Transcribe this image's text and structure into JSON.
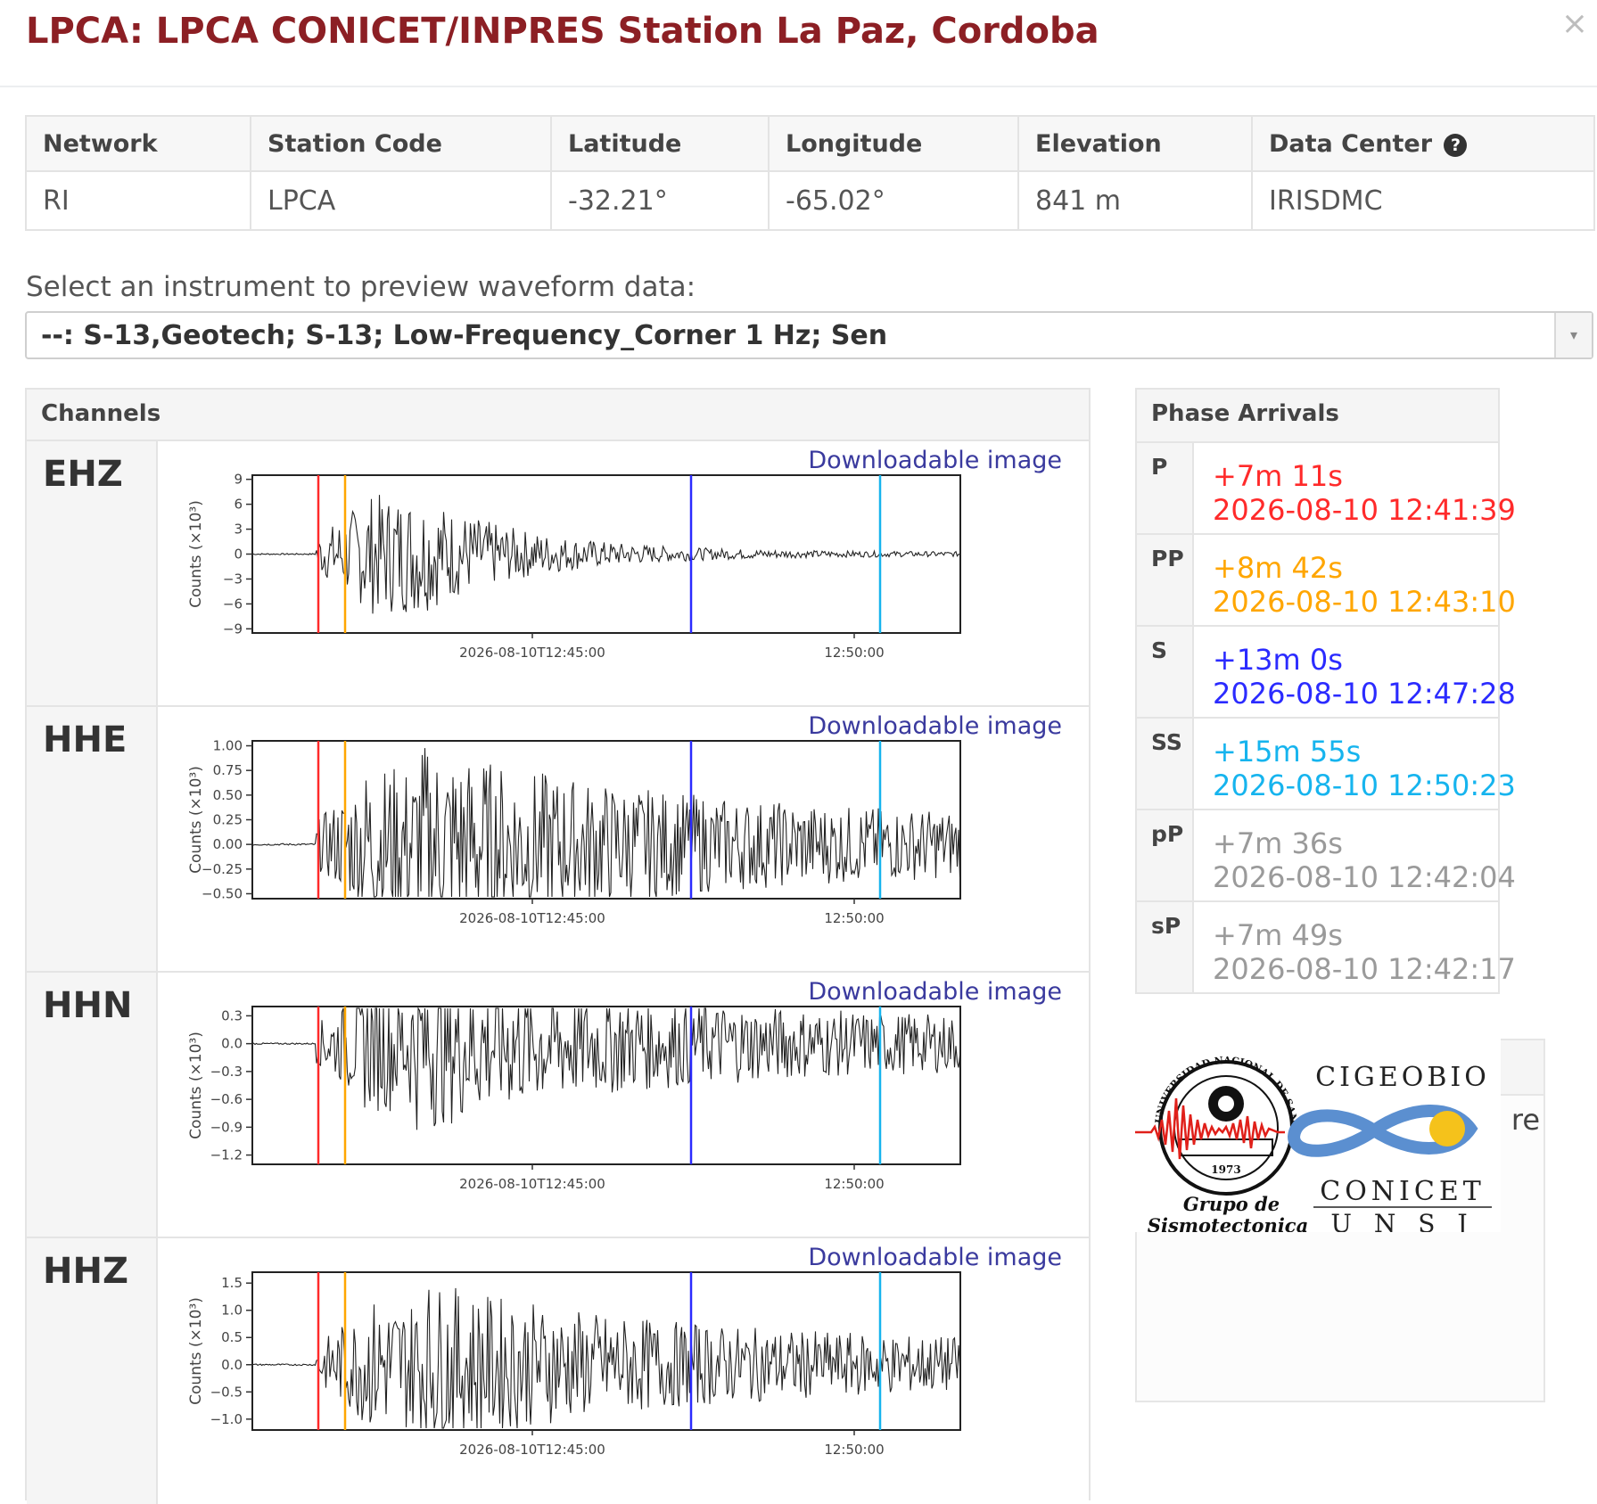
{
  "modal": {
    "title": "LPCA: LPCA CONICET/INPRES Station La Paz, Cordoba",
    "close": "×"
  },
  "station_table": {
    "headers": [
      "Network",
      "Station Code",
      "Latitude",
      "Longitude",
      "Elevation",
      "Data Center"
    ],
    "row": [
      "RI",
      "LPCA",
      "-32.21°",
      "-65.02°",
      "841 m",
      "IRISDMC"
    ],
    "help_icon": "?"
  },
  "instrument": {
    "label": "Select an instrument to preview waveform data:",
    "selected": "--: S-13,Geotech; S-13; Low-Frequency_Corner 1 Hz; Sen",
    "caret": "▾"
  },
  "channels": {
    "heading": "Channels",
    "download_label": "Downloadable image",
    "items": [
      {
        "code": "EHZ",
        "yticks": [
          "9",
          "6",
          "3",
          "0",
          "−3",
          "−6",
          "−9"
        ],
        "ylabel": "Counts (×10³)"
      },
      {
        "code": "HHE",
        "yticks": [
          "1.00",
          "0.75",
          "0.50",
          "0.25",
          "0.00",
          "−0.25",
          "−0.50"
        ],
        "ylabel": "Counts (×10³)"
      },
      {
        "code": "HHN",
        "yticks": [
          "0.3",
          "0.0",
          "−0.3",
          "−0.6",
          "−0.9",
          "−1.2"
        ],
        "ylabel": "Counts (×10³)"
      },
      {
        "code": "HHZ",
        "yticks": [
          "1.5",
          "1.0",
          "0.5",
          "0.0",
          "−0.5",
          "−1.0"
        ],
        "ylabel": "Counts (×10³)"
      }
    ],
    "xticks": [
      "2026-08-10T12:45:00",
      "12:50:00"
    ]
  },
  "phase_arrivals": {
    "heading": "Phase Arrivals",
    "items": [
      {
        "phase": "P",
        "relative": "+7m 11s",
        "time": "2026-08-10 12:41:39",
        "color": "#ff2a2a"
      },
      {
        "phase": "PP",
        "relative": "+8m 42s",
        "time": "2026-08-10 12:43:10",
        "color": "#ffa600"
      },
      {
        "phase": "S",
        "relative": "+13m 0s",
        "time": "2026-08-10 12:47:28",
        "color": "#2b2bff"
      },
      {
        "phase": "SS",
        "relative": "+15m 55s",
        "time": "2026-08-10 12:50:23",
        "color": "#16b4ee"
      },
      {
        "phase": "pP",
        "relative": "+7m 36s",
        "time": "2026-08-10 12:42:04",
        "color": "#9a9a9a"
      },
      {
        "phase": "sP",
        "relative": "+7m 49s",
        "time": "2026-08-10 12:42:17",
        "color": "#9a9a9a"
      }
    ]
  },
  "partial_panel": {
    "text": "re"
  },
  "logo": {
    "seal_text": "UNIVERSIDAD NACIONAL DE SAN JUAN",
    "seal_year": "1973",
    "group_line1": "Grupo de",
    "group_line2": "Sismotectonica",
    "brand1": "CIGEOBIO",
    "brand2": "CONICET",
    "brand3": "U N S J"
  },
  "colors": {
    "title": "#8c1f24",
    "link": "#3a3a9e",
    "P": "#ff2a2a",
    "PP": "#ffa600",
    "S": "#2b2bff",
    "SS": "#16b4ee"
  },
  "chart_data": [
    {
      "type": "line",
      "title": "",
      "xlabel": "",
      "ylabel": "Counts (×10³)",
      "x_ticks": [
        "2026-08-10T12:45:00",
        "12:50:00"
      ],
      "ylim": [
        -9.5,
        9.5
      ],
      "phase_markers": [
        "2026-08-10 12:41:39",
        "2026-08-10 12:43:10",
        "2026-08-10 12:47:28",
        "2026-08-10 12:50:23"
      ],
      "series": [
        {
          "name": "EHZ",
          "peak_abs": 9
        }
      ]
    },
    {
      "type": "line",
      "title": "",
      "xlabel": "",
      "ylabel": "Counts (×10³)",
      "x_ticks": [
        "2026-08-10T12:45:00",
        "12:50:00"
      ],
      "ylim": [
        -0.55,
        1.05
      ],
      "phase_markers": [
        "2026-08-10 12:41:39",
        "2026-08-10 12:43:10",
        "2026-08-10 12:47:28",
        "2026-08-10 12:50:23"
      ],
      "series": [
        {
          "name": "HHE",
          "peak_abs": 1.0
        }
      ]
    },
    {
      "type": "line",
      "title": "",
      "xlabel": "",
      "ylabel": "Counts (×10³)",
      "x_ticks": [
        "2026-08-10T12:45:00",
        "12:50:00"
      ],
      "ylim": [
        -1.3,
        0.4
      ],
      "phase_markers": [
        "2026-08-10 12:41:39",
        "2026-08-10 12:43:10",
        "2026-08-10 12:47:28",
        "2026-08-10 12:50:23"
      ],
      "series": [
        {
          "name": "HHN",
          "peak_abs": 0.9
        }
      ]
    },
    {
      "type": "line",
      "title": "",
      "xlabel": "",
      "ylabel": "Counts (×10³)",
      "x_ticks": [
        "2026-08-10T12:45:00",
        "12:50:00"
      ],
      "ylim": [
        -1.2,
        1.7
      ],
      "phase_markers": [
        "2026-08-10 12:41:39",
        "2026-08-10 12:43:10",
        "2026-08-10 12:47:28",
        "2026-08-10 12:50:23"
      ],
      "series": [
        {
          "name": "HHZ",
          "peak_abs": 1.5
        }
      ]
    }
  ]
}
